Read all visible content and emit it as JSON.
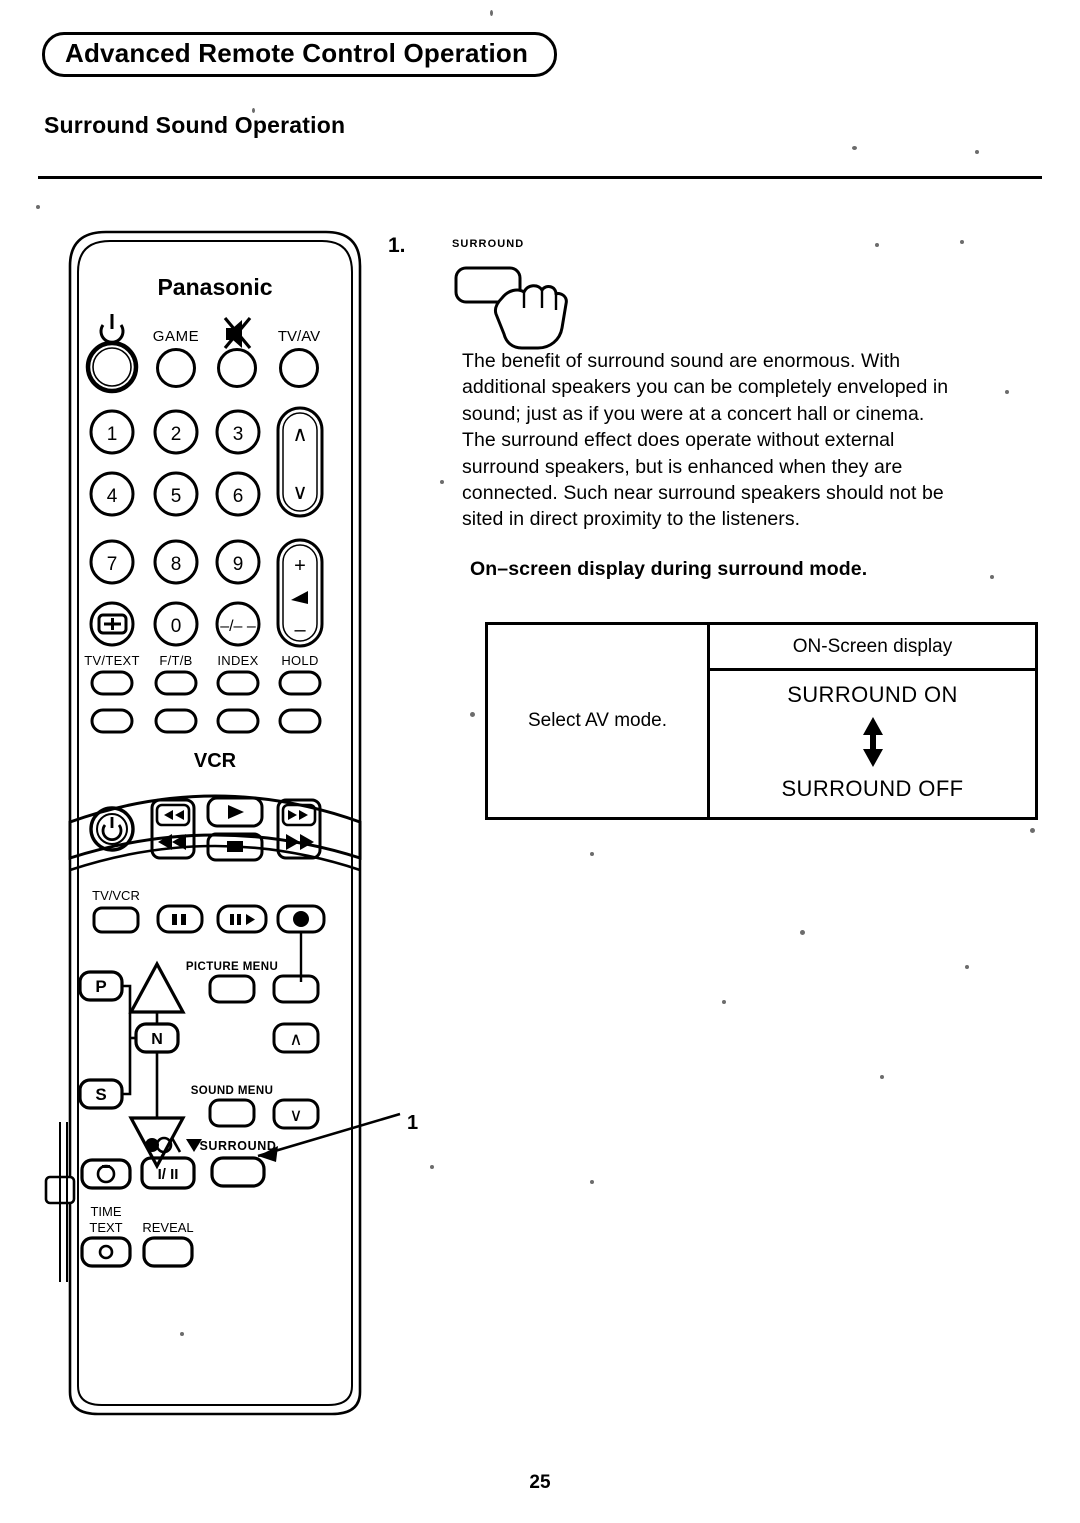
{
  "header": {
    "title": "Advanced Remote Control Operation",
    "section_title": "Surround Sound Operation"
  },
  "step": {
    "number": "1.",
    "key_label": "SURROUND",
    "press_icon": "hand-pressing-button-icon"
  },
  "body": {
    "paragraph": "The benefit of surround sound are enormous. With additional speakers you can be completely enveloped in sound; just as if you were at a concert hall or cinema. The surround effect does operate without external surround speakers, but is enhanced when they are connected. Such near surround speakers should not be sited in direct proximity to the listeners.",
    "sub_head": "On–screen display during surround mode."
  },
  "osd_table": {
    "left_cell": "Select AV mode.",
    "right_header": "ON-Screen display",
    "state_on": "SURROUND ON",
    "state_off": "SURROUND OFF",
    "arrow_icon": "up-down-arrow-icon"
  },
  "callout": {
    "number": "1",
    "target": "surround-button"
  },
  "remote": {
    "brand": "Panasonic",
    "top_row": [
      {
        "label": "",
        "icon": "power-icon",
        "name": "power-button"
      },
      {
        "label": "GAME",
        "icon": "",
        "name": "game-button"
      },
      {
        "label": "",
        "icon": "mute-icon",
        "name": "mute-button"
      },
      {
        "label": "TV/AV",
        "icon": "",
        "name": "tv-av-button"
      }
    ],
    "keypad": [
      [
        "1",
        "2",
        "3"
      ],
      [
        "4",
        "5",
        "6"
      ],
      [
        "7",
        "8",
        "9"
      ]
    ],
    "keypad_last_row": [
      {
        "label": "",
        "icon": "boxed-plus-icon",
        "name": "sub-page-button"
      },
      {
        "label": "0",
        "icon": "",
        "name": "digit-0-button"
      },
      {
        "label": "–/––",
        "icon": "",
        "name": "single-double-digit-button"
      }
    ],
    "channel_rocker": {
      "up": "∧",
      "down": "∨",
      "name": "channel-rocker"
    },
    "volume_rocker": {
      "up": "+",
      "down": "–",
      "icon": "speaker-icon",
      "name": "volume-rocker"
    },
    "function_row": [
      "TV/TEXT",
      "F/T/B",
      "INDEX",
      "HOLD"
    ],
    "function_row2": [
      "",
      "",
      "",
      ""
    ],
    "vcr_label": "VCR",
    "vcr_transport": [
      {
        "icon": "power-icon",
        "name": "vcr-power-button"
      },
      {
        "icon": "rewind-icon",
        "name": "rewind-button"
      },
      {
        "icon": "play-icon",
        "name": "play-button"
      },
      {
        "icon": "stop-icon",
        "name": "stop-button"
      },
      {
        "icon": "fast-forward-icon",
        "name": "fast-forward-button"
      }
    ],
    "vcr_row2": [
      {
        "label": "TV/VCR",
        "icon": "",
        "name": "tv-vcr-button"
      },
      {
        "label": "",
        "icon": "pause-icon",
        "name": "pause-button"
      },
      {
        "label": "",
        "icon": "slow-icon",
        "name": "slow-button"
      },
      {
        "label": "",
        "icon": "record-icon",
        "name": "record-button"
      }
    ],
    "menu_cluster": {
      "p_label": "P",
      "n_label": "N",
      "s_label": "S",
      "up_icon": "up-triangle-icon",
      "down_icon": "down-triangle-icon",
      "picture_menu": "PICTURE MENU",
      "sound_menu": "SOUND MENU",
      "nav_up": "∧",
      "nav_down": "∨"
    },
    "bottom_cluster": {
      "index_icon": "teletext-index-icon",
      "i_ii_label": "I/ II",
      "i_ii_icon": "stereo-bilingual-icon",
      "surround_label": "SURROUND",
      "time_text_label": "TIME TEXT",
      "time_text_line1": "TIME",
      "time_text_line2": "TEXT",
      "reveal_label": "REVEAL"
    }
  },
  "page_number": "25"
}
